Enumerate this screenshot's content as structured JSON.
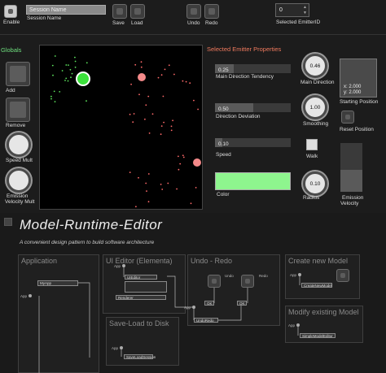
{
  "toolbar": {
    "enable_label": "Enable",
    "session_name_value": "Session Name",
    "session_name_label": "Session Name",
    "save_label": "Save",
    "load_label": "Load",
    "undo_label": "Undo",
    "redo_label": "Redo",
    "emitter_id_value": "0",
    "emitter_id_label": "Selected EmitterID"
  },
  "globals": {
    "title": "Globals",
    "add_label": "Add",
    "remove_label": "Remove",
    "speed_mult_label": "Speed Mult",
    "emission_velocity_mult_label1": "Emission",
    "emission_velocity_mult_label2": "Velocity Mult"
  },
  "emitter": {
    "title": "Selected Emitter Properties",
    "main_direction_tendency": {
      "value": "0.25",
      "fraction": 0.25,
      "label": "Main Direction Tendency"
    },
    "main_direction": {
      "value": "0.46",
      "label": "Main Direction"
    },
    "starting_position": {
      "x": "x: 2.000",
      "y": "y: 2.000",
      "label": "Starting Position"
    },
    "direction_deviation": {
      "value": "0.50",
      "fraction": 0.5,
      "label": "Direction Deviation"
    },
    "smoothing": {
      "value": "1.00",
      "label": "Smoothing"
    },
    "reset_position_label": "Reset Position",
    "speed": {
      "value": "0.10",
      "fraction": 0.1,
      "label": "Speed"
    },
    "walk_label": "Walk",
    "color_label": "Color",
    "color_hex": "#8ef58e",
    "radius": {
      "value": "0.10",
      "label": "Radius"
    },
    "emission_velocity": {
      "fraction": 0.45,
      "label1": "Emission",
      "label2": "Velocity"
    }
  },
  "doc": {
    "title": "Model-Runtime-Editor",
    "subtitle": "A convenient design pattern to build software architecture",
    "panels": {
      "application": {
        "title": "Application",
        "nodes": [
          "MyApp"
        ],
        "port": "App"
      },
      "ui_editor": {
        "title": "UI Editor (Elementa)",
        "nodes": [
          "UIEditor",
          "Renderer"
        ],
        "port": "App"
      },
      "undo_redo": {
        "title": "Undo - Redo",
        "undo": "Undo",
        "redo": "Redo",
        "ok1": "OK",
        "ok2": "OK",
        "node": "UndoRedo",
        "port": "App"
      },
      "save_load": {
        "title": "Save-Load to Disk",
        "node": "SaveLoadSession",
        "port": "App"
      },
      "create_model": {
        "title": "Create new Model",
        "node": "CreateNewModel",
        "port": "App"
      },
      "modify_model": {
        "title": "Modify existing Model",
        "node": "SimpleModelEditor",
        "port": "App"
      }
    }
  },
  "colors": {
    "accent_orange": "#f07a5e",
    "accent_green": "#6fe07f",
    "particle_red": "#ff6a6a",
    "particle_green": "#5de35d"
  }
}
